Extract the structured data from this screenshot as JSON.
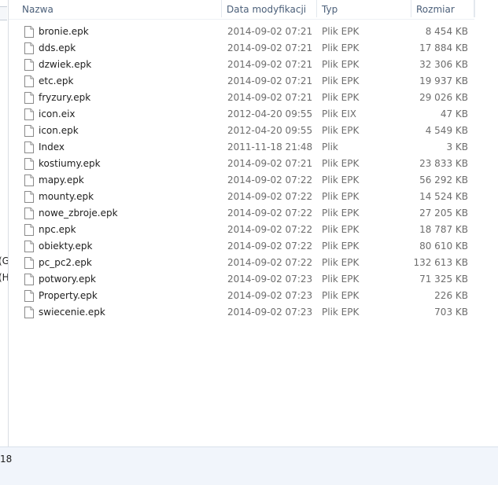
{
  "columns": {
    "name": "Nazwa",
    "date": "Data modyfikacji",
    "type": "Typ",
    "size": "Rozmiar"
  },
  "nav_fragments": [
    "(G",
    "(H"
  ],
  "status": {
    "text": "18"
  },
  "files": [
    {
      "name": "bronie.epk",
      "date": "2014-09-02 07:21",
      "type": "Plik EPK",
      "size": "8 454 KB"
    },
    {
      "name": "dds.epk",
      "date": "2014-09-02 07:21",
      "type": "Plik EPK",
      "size": "17 884 KB"
    },
    {
      "name": "dzwiek.epk",
      "date": "2014-09-02 07:21",
      "type": "Plik EPK",
      "size": "32 306 KB"
    },
    {
      "name": "etc.epk",
      "date": "2014-09-02 07:21",
      "type": "Plik EPK",
      "size": "19 937 KB"
    },
    {
      "name": "fryzury.epk",
      "date": "2014-09-02 07:21",
      "type": "Plik EPK",
      "size": "29 026 KB"
    },
    {
      "name": "icon.eix",
      "date": "2012-04-20 09:55",
      "type": "Plik EIX",
      "size": "47 KB"
    },
    {
      "name": "icon.epk",
      "date": "2012-04-20 09:55",
      "type": "Plik EPK",
      "size": "4 549 KB"
    },
    {
      "name": "Index",
      "date": "2011-11-18 21:48",
      "type": "Plik",
      "size": "3 KB"
    },
    {
      "name": "kostiumy.epk",
      "date": "2014-09-02 07:21",
      "type": "Plik EPK",
      "size": "23 833 KB"
    },
    {
      "name": "mapy.epk",
      "date": "2014-09-02 07:22",
      "type": "Plik EPK",
      "size": "56 292 KB"
    },
    {
      "name": "mounty.epk",
      "date": "2014-09-02 07:22",
      "type": "Plik EPK",
      "size": "14 524 KB"
    },
    {
      "name": "nowe_zbroje.epk",
      "date": "2014-09-02 07:22",
      "type": "Plik EPK",
      "size": "27 205 KB"
    },
    {
      "name": "npc.epk",
      "date": "2014-09-02 07:22",
      "type": "Plik EPK",
      "size": "18 787 KB"
    },
    {
      "name": "obiekty.epk",
      "date": "2014-09-02 07:22",
      "type": "Plik EPK",
      "size": "80 610 KB"
    },
    {
      "name": "pc_pc2.epk",
      "date": "2014-09-02 07:22",
      "type": "Plik EPK",
      "size": "132 613 KB"
    },
    {
      "name": "potwory.epk",
      "date": "2014-09-02 07:23",
      "type": "Plik EPK",
      "size": "71 325 KB"
    },
    {
      "name": "Property.epk",
      "date": "2014-09-02 07:23",
      "type": "Plik EPK",
      "size": "226 KB"
    },
    {
      "name": "swiecenie.epk",
      "date": "2014-09-02 07:23",
      "type": "Plik EPK",
      "size": "703 KB"
    }
  ]
}
